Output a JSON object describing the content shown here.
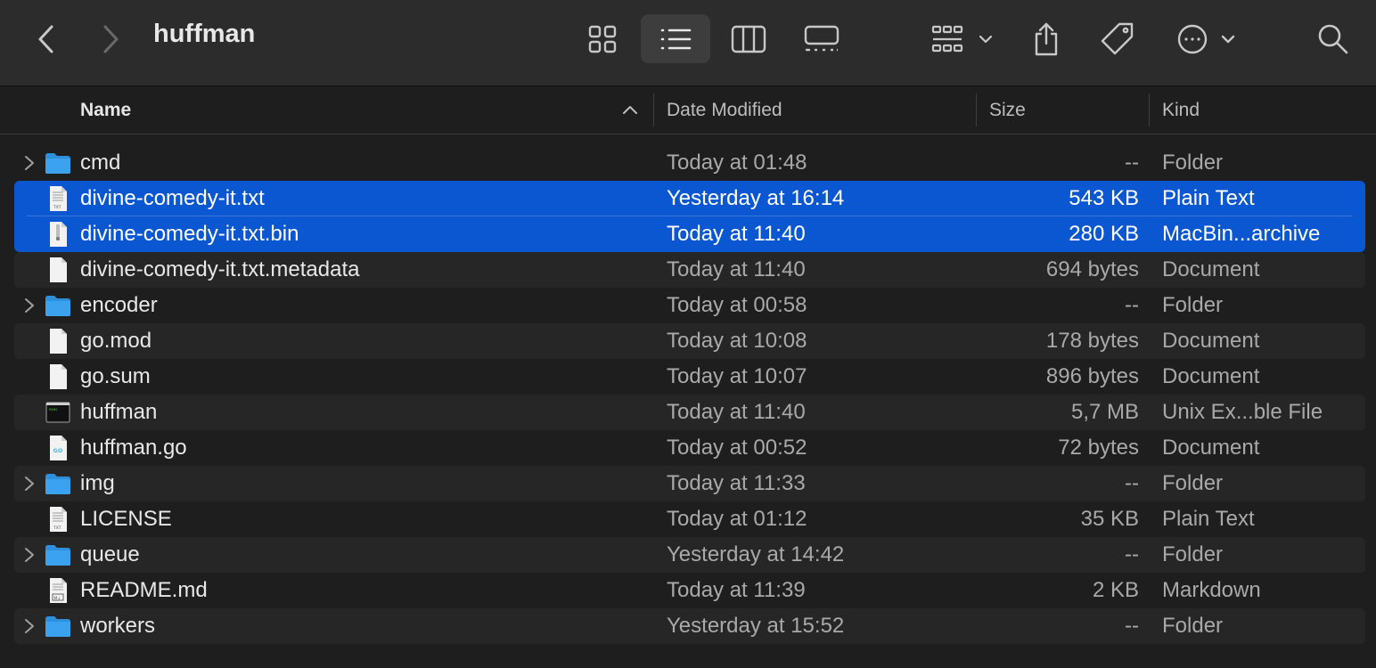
{
  "window": {
    "title": "huffman"
  },
  "toolbar": {
    "icons": [
      "back-icon",
      "forward-icon",
      "grid-view-icon",
      "list-view-icon",
      "column-view-icon",
      "gallery-view-icon",
      "group-icon",
      "share-icon",
      "tag-icon",
      "more-icon",
      "search-icon"
    ],
    "selected_view": "list-view-icon"
  },
  "columns": {
    "name": "Name",
    "date": "Date Modified",
    "size": "Size",
    "kind": "Kind"
  },
  "colors": {
    "selection": "#0a57d1",
    "folder": "#3ba2f0",
    "background": "#1e1e1e"
  },
  "files": [
    {
      "name": "cmd",
      "date": "Today at 01:48",
      "size": "--",
      "kind": "Folder",
      "type": "folder",
      "selected": false
    },
    {
      "name": "divine-comedy-it.txt",
      "date": "Yesterday at 16:14",
      "size": "543 KB",
      "kind": "Plain Text",
      "type": "txt",
      "selected": true
    },
    {
      "name": "divine-comedy-it.txt.bin",
      "date": "Today at 11:40",
      "size": "280 KB",
      "kind": "MacBin...archive",
      "type": "bin",
      "selected": true
    },
    {
      "name": "divine-comedy-it.txt.metadata",
      "date": "Today at 11:40",
      "size": "694 bytes",
      "kind": "Document",
      "type": "doc",
      "selected": false
    },
    {
      "name": "encoder",
      "date": "Today at 00:58",
      "size": "--",
      "kind": "Folder",
      "type": "folder",
      "selected": false
    },
    {
      "name": "go.mod",
      "date": "Today at 10:08",
      "size": "178 bytes",
      "kind": "Document",
      "type": "doc",
      "selected": false
    },
    {
      "name": "go.sum",
      "date": "Today at 10:07",
      "size": "896 bytes",
      "kind": "Document",
      "type": "doc",
      "selected": false
    },
    {
      "name": "huffman",
      "date": "Today at 11:40",
      "size": "5,7 MB",
      "kind": "Unix Ex...ble File",
      "type": "exec",
      "selected": false
    },
    {
      "name": "huffman.go",
      "date": "Today at 00:52",
      "size": "72 bytes",
      "kind": "Document",
      "type": "go",
      "selected": false
    },
    {
      "name": "img",
      "date": "Today at 11:33",
      "size": "--",
      "kind": "Folder",
      "type": "folder",
      "selected": false
    },
    {
      "name": "LICENSE",
      "date": "Today at 01:12",
      "size": "35 KB",
      "kind": "Plain Text",
      "type": "txt",
      "selected": false
    },
    {
      "name": "queue",
      "date": "Yesterday at 14:42",
      "size": "--",
      "kind": "Folder",
      "type": "folder",
      "selected": false
    },
    {
      "name": "README.md",
      "date": "Today at 11:39",
      "size": "2 KB",
      "kind": "Markdown",
      "type": "md",
      "selected": false
    },
    {
      "name": "workers",
      "date": "Yesterday at 15:52",
      "size": "--",
      "kind": "Folder",
      "type": "folder",
      "selected": false
    }
  ]
}
